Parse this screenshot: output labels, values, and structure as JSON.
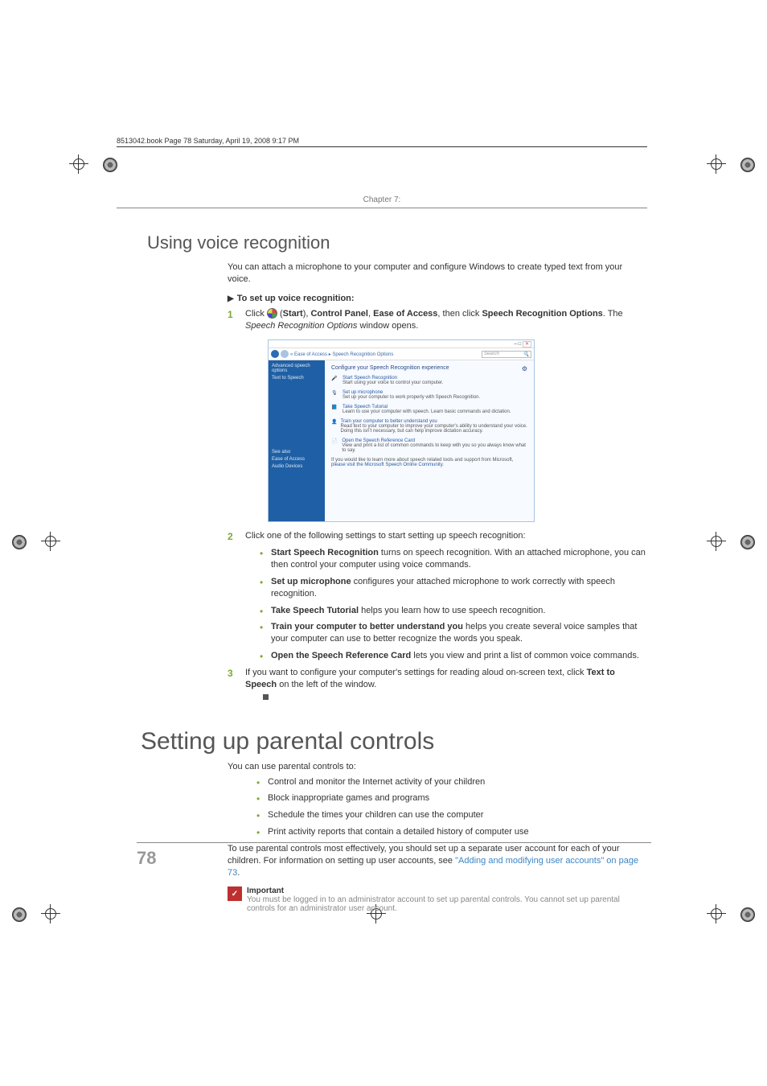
{
  "header_line": "8513042.book  Page 78  Saturday, April 19, 2008  9:17 PM",
  "chapter": "Chapter 7:",
  "section1": {
    "title": "Using voice recognition",
    "intro": "You can attach a microphone to your computer and configure Windows to create typed text from your voice.",
    "procedure_title": "To set up voice recognition:",
    "step1_prefix": "Click ",
    "step1_start": "Start",
    "step1_cp": "Control Panel",
    "step1_ea": "Ease of Access",
    "step1_then": ", then click ",
    "step1_sro": "Speech Recognition Options",
    "step1_suffix": ". The ",
    "step1_window": "Speech Recognition Options",
    "step1_end": " window opens.",
    "step2": "Click one of the following settings to start setting up speech recognition:",
    "b1_t": "Start Speech Recognition",
    "b1_d": " turns on speech recognition. With an attached microphone, you can then control your computer using voice commands.",
    "b2_t": "Set up microphone",
    "b2_d": " configures your attached microphone to work correctly with speech recognition.",
    "b3_t": "Take Speech Tutorial",
    "b3_d": " helps you learn how to use speech recognition.",
    "b4_t": "Train your computer to better understand you",
    "b4_d": " helps you create several voice samples that your computer can use to better recognize the words you speak.",
    "b5_t": "Open the Speech Reference Card",
    "b5_d": " lets you view and print a list of common voice commands.",
    "step3_a": "If you want to configure your computer's settings for reading aloud on-screen text, click ",
    "step3_b": "Text to Speech",
    "step3_c": " on the left of the window."
  },
  "screenshot": {
    "close": "✕",
    "breadcrumb": "« Ease of Access ▸ Speech Recognition Options",
    "search_placeholder": "Search",
    "sidebar1": "Advanced speech options",
    "sidebar2": "Text to Speech",
    "sidebar3": "See also",
    "sidebar4": "Ease of Access",
    "sidebar5": "Audio Devices",
    "main_title": "Configure your Speech Recognition experience",
    "i1_t": "Start Speech Recognition",
    "i1_d": "Start using your voice to control your computer.",
    "i2_t": "Set up microphone",
    "i2_d": "Set up your computer to work properly with Speech Recognition.",
    "i3_t": "Take Speech Tutorial",
    "i3_d": "Learn to use your computer with speech. Learn basic commands and dictation.",
    "i4_t": "Train your computer to better understand you",
    "i4_d": "Read text to your computer to improve your computer's ability to understand your voice. Doing this isn't necessary, but can help improve dictation accuracy.",
    "i5_t": "Open the Speech Reference Card",
    "i5_d": "View and print a list of common commands to keep with you so you always know what to say.",
    "foot_a": "If you would like to learn more about speech related tools and support from Microsoft, ",
    "foot_link": "please visit the Microsoft Speech Online Community",
    "foot_b": "."
  },
  "section2": {
    "title": "Setting up parental controls",
    "intro": "You can use parental controls to:",
    "b1": "Control and monitor the Internet activity of your children",
    "b2": "Block inappropriate games and programs",
    "b3": "Schedule the times your children can use the computer",
    "b4": "Print activity reports that contain a detailed history of computer use",
    "para_a": "To use parental controls most effectively, you should set up a separate user account for each of your children. For information on setting up user accounts, see ",
    "para_link": "\"Adding and modifying user accounts\" on page 73",
    "para_b": ".",
    "imp_title": "Important",
    "imp_body": "You must be logged in to an administrator account to set up parental controls. You cannot set up parental controls for an administrator user account."
  },
  "page_num": "78"
}
